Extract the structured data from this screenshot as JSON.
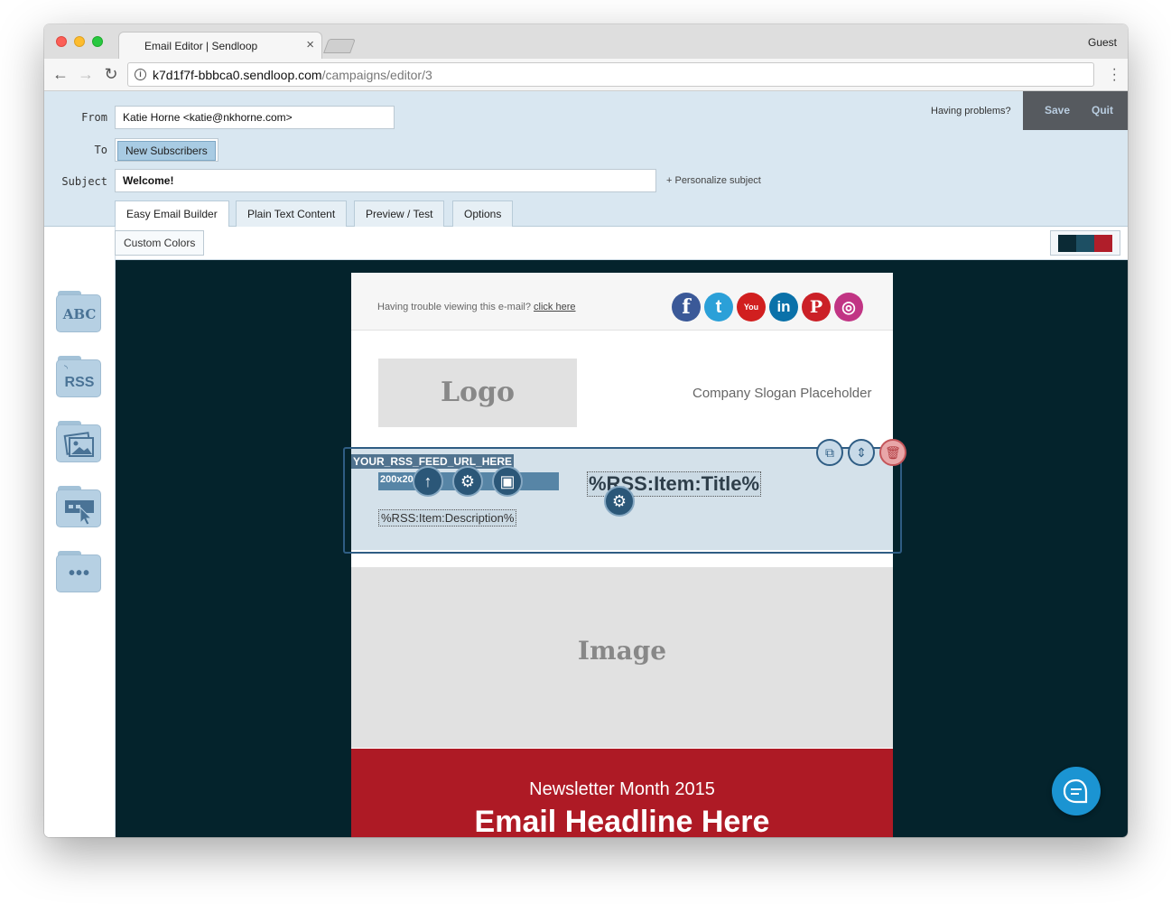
{
  "browser": {
    "tab_title": "Email Editor | Sendloop",
    "tab_close": "×",
    "profile": "Guest",
    "url_host": "k7d1f7f-bbbca0.sendloop.com",
    "url_path": "/campaigns/editor/3"
  },
  "header": {
    "from_label": "From",
    "from_value": "Katie Horne <katie@nkhorne.com>",
    "to_label": "To",
    "to_value": "New Subscribers",
    "subject_label": "Subject",
    "subject_value": "Welcome!",
    "personalize": "+ Personalize subject",
    "problems": "Having problems?",
    "save": "Save",
    "quit": "Quit"
  },
  "tabs": [
    "Easy Email Builder",
    "Plain Text Content",
    "Preview / Test",
    "Options"
  ],
  "toolbar": {
    "custom_colors": "Custom Colors",
    "swatches": [
      "#0b2a35",
      "#1d4f63",
      "#b01e2a"
    ]
  },
  "tools": [
    {
      "name": "text-block-tool",
      "icon": "abc-icon",
      "label": "ABC"
    },
    {
      "name": "rss-block-tool",
      "icon": "rss-icon",
      "label": "RSS"
    },
    {
      "name": "image-block-tool",
      "icon": "image-icon",
      "label": ""
    },
    {
      "name": "button-block-tool",
      "icon": "cursor-icon",
      "label": ""
    },
    {
      "name": "more-blocks-tool",
      "icon": "dots-icon",
      "label": "•••"
    }
  ],
  "email": {
    "preheader": "Having trouble viewing this e-mail?",
    "preheader_link": "click here",
    "social": [
      {
        "icon": "facebook-icon",
        "glyph": "f",
        "color": "#3b5998"
      },
      {
        "icon": "twitter-icon",
        "glyph": "t",
        "color": "#2ba0d8"
      },
      {
        "icon": "youtube-icon",
        "glyph": "You",
        "color": "#d11f1f"
      },
      {
        "icon": "linkedin-icon",
        "glyph": "in",
        "color": "#0a71a9"
      },
      {
        "icon": "pinterest-icon",
        "glyph": "P",
        "color": "#cb2027"
      },
      {
        "icon": "instagram-icon",
        "glyph": "◎",
        "color": "#c13584"
      }
    ],
    "logo": "Logo",
    "slogan": "Company Slogan Placeholder",
    "rss_feed_url": "YOUR_RSS_FEED_URL_HERE",
    "rss_image_size": "200x20",
    "rss_title": "%RSS:Item:Title%",
    "rss_description": "%RSS:Item:Description%",
    "image_placeholder": "Image",
    "newsletter_sub": "Newsletter Month 2015",
    "headline": "Email Headline Here"
  }
}
